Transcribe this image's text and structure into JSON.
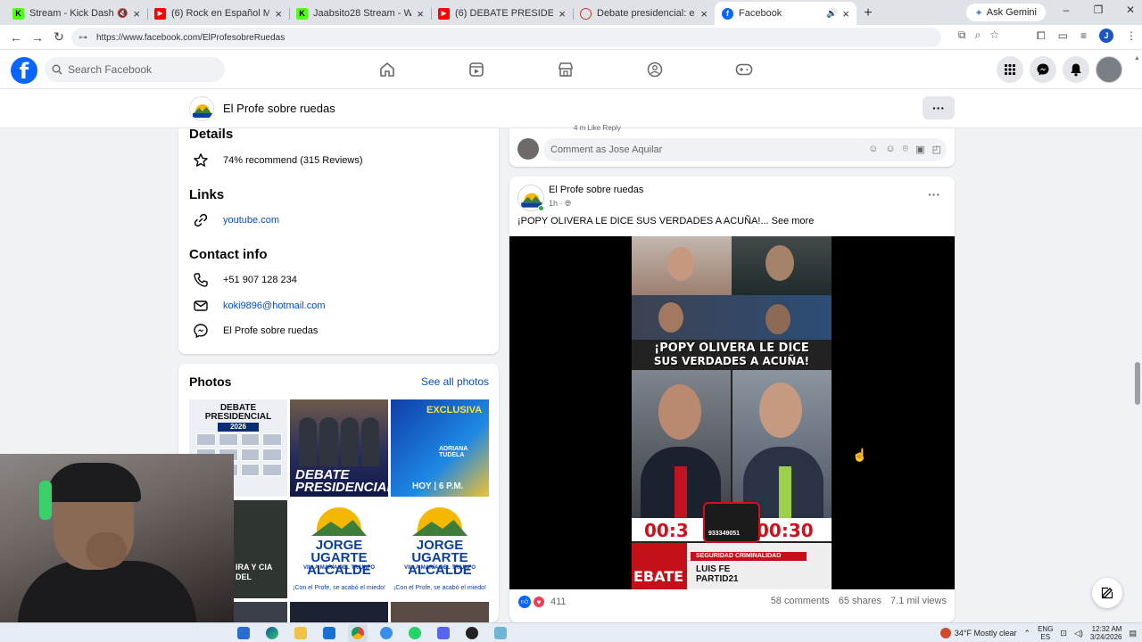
{
  "browser": {
    "tabs": [
      {
        "title": "Stream - Kick Dashboard",
        "favicon": "kick-icon",
        "muted": true
      },
      {
        "title": "(6) Rock en Español Mix #1 | So",
        "favicon": "youtube-icon",
        "muted": false
      },
      {
        "title": "Jaabsito28 Stream - Watch Live",
        "favicon": "kick-icon",
        "muted": false
      },
      {
        "title": "(6) DEBATE PRESIDENCIAL DEL",
        "favicon": "youtube-icon",
        "muted": false
      },
      {
        "title": "Debate presidencial: estos son",
        "favicon": "web-icon",
        "muted": false
      },
      {
        "title": "Facebook",
        "favicon": "facebook-icon",
        "muted": false,
        "active": true
      }
    ],
    "gemini_label": "Ask Gemini",
    "url": "https://www.facebook.com/ElProfesobreRuedas",
    "profile_initial": "J"
  },
  "facebook": {
    "logo": "f",
    "search_placeholder": "Search Facebook",
    "nav_icons": [
      "home-icon",
      "video-icon",
      "marketplace-icon",
      "groups-icon",
      "gaming-icon"
    ],
    "right_icons": [
      "menu-grid-icon",
      "messenger-icon",
      "notifications-icon",
      "account-avatar"
    ]
  },
  "page": {
    "name": "El Profe sobre ruedas",
    "more_label": "···"
  },
  "intro": {
    "details_title": "Details",
    "recommend": "74% recommend (315 Reviews)",
    "links_title": "Links",
    "link": "youtube.com",
    "contact_title": "Contact info",
    "phone": "+51 907 128 234",
    "email": "koki9896@hotmail.com",
    "messenger": "El Profe sobre ruedas"
  },
  "photos": {
    "title": "Photos",
    "see_all": "See all photos",
    "items": [
      {
        "debate": "DEBATE",
        "presidencial": "PRESIDENCIAL",
        "year": "2026"
      },
      {
        "line1": "DEBATE",
        "line2": "PRESIDENCIAL"
      },
      {
        "tag": "EXCLUSIVA",
        "name": "ADRIANA TUDELA",
        "time": "HOY | 6 P.M."
      },
      {
        "text": "IRA Y CIA DEL"
      },
      {
        "line1": "JORGE UGARTE",
        "line2": "ALCALDE",
        "line3": "VILLA MARÍA DEL TRIUNFO",
        "slogan": "¡Con el Profe, se acabó el miedo!"
      },
      {
        "line1": "JORGE UGARTE",
        "line2": "ALCALDE",
        "line3": "VILLA MARÍA DEL TRIUNFO",
        "slogan": "¡Con el Profe, se acabó el miedo!"
      }
    ]
  },
  "comment": {
    "previous_meta": "4 m   Like   Reply",
    "placeholder": "Comment as Jose Aquilar"
  },
  "post": {
    "author": "El Profe sobre ruedas",
    "time": "1h · ",
    "text": "¡POPY OLIVERA LE DICE SUS VERDADES A ACUÑA!...",
    "see_more": "See more",
    "video": {
      "title1": "¡POPY OLIVERA LE DICE",
      "title2": "SUS VERDADES A ACUÑA!",
      "timer_left": "00:3",
      "timer_right": "00:30",
      "logo_text": "933349051",
      "bottom_left": "EBATE",
      "segment": "SEGURIDAD CRIMINALIDAD",
      "candidate_line1": "LUIS FE",
      "candidate_line2": "PARTID21"
    },
    "reaction_count": "411",
    "comments": "58 comments",
    "shares": "65 shares",
    "views": "7.1 mil views"
  },
  "taskbar": {
    "weather": "34°F  Mostly clear",
    "lang_line1": "ENG",
    "lang_line2": "ES",
    "time": "12:32 AM",
    "date": "3/24/2026"
  }
}
